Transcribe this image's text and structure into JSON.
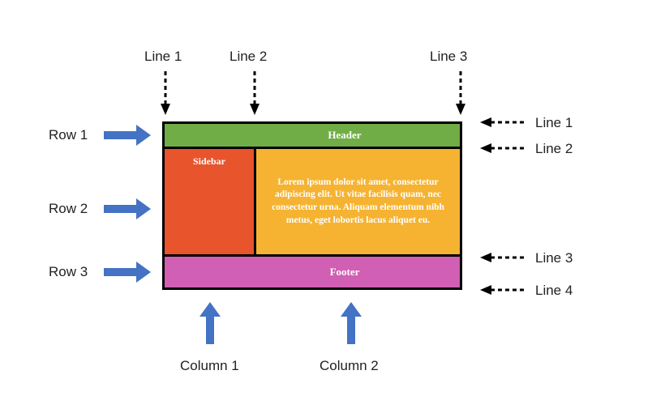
{
  "top_lines": {
    "line1": "Line 1",
    "line2": "Line 2",
    "line3": "Line 3"
  },
  "right_lines": {
    "line1": "Line 1",
    "line2": "Line 2",
    "line3": "Line 3",
    "line4": "Line 4"
  },
  "left_rows": {
    "row1": "Row 1",
    "row2": "Row 2",
    "row3": "Row 3"
  },
  "bottom_cols": {
    "col1": "Column 1",
    "col2": "Column 2"
  },
  "grid": {
    "header": "Header",
    "sidebar": "Sidebar",
    "content": "Lorem ipsum dolor sit amet, consectetur adipiscing elit. Ut vitae facilisis quam, nec consectetur urna. Aliquam elementum nibh metus, eget lobortis lacus aliquet eu.",
    "footer": "Footer"
  }
}
